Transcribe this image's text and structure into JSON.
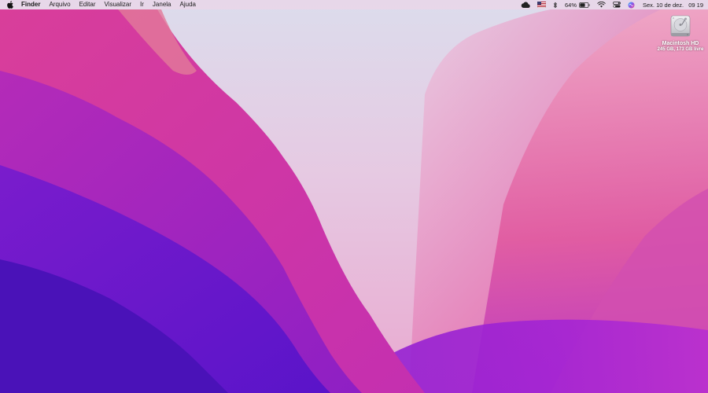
{
  "menubar": {
    "app_name": "Finder",
    "menus": [
      "Arquivo",
      "Editar",
      "Visualizar",
      "Ir",
      "Janela",
      "Ajuda"
    ],
    "status": {
      "icons": [
        "icloud-icon",
        "input-source-flag-icon",
        "bluetooth-icon",
        "battery-icon",
        "wifi-icon",
        "control-center-icon",
        "siri-icon"
      ],
      "battery_percent": "64%",
      "battery_level": 0.64
    },
    "clock": {
      "date": "Sex. 10 de dez.",
      "time": "09 19"
    }
  },
  "desktop": {
    "volume": {
      "name": "Macintosh HD",
      "info": "245 GB, 173 GB livre"
    }
  },
  "colors": {
    "menubar_bg": "#ecd6e8",
    "wallpaper_top": "#e9d4e6",
    "wallpaper_magenta": "#d238b4",
    "wallpaper_violet": "#5a17c9",
    "wallpaper_pink": "#e85aa0"
  }
}
